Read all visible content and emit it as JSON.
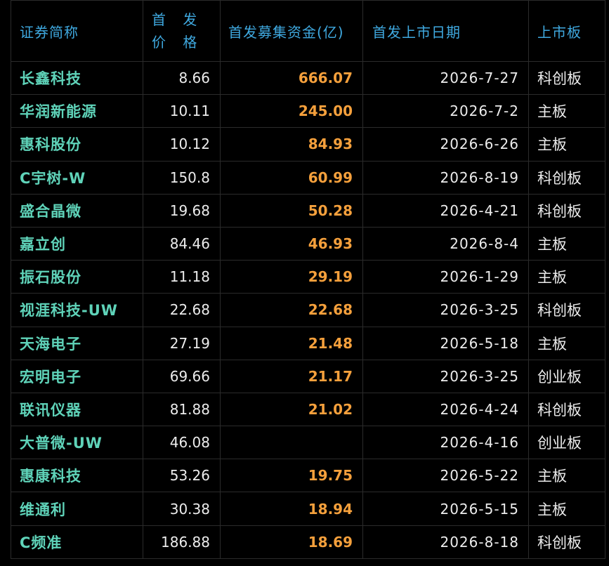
{
  "headers": {
    "name": "证券简称",
    "price": "首 发 价 格",
    "fund": "首发募集资金(亿)",
    "date": "首发上市日期",
    "board": "上市板"
  },
  "rows": [
    {
      "name": "长鑫科技",
      "price": "8.66",
      "fund": "666.07",
      "date": "2026-7-27",
      "board": "科创板"
    },
    {
      "name": "华润新能源",
      "price": "10.11",
      "fund": "245.00",
      "date": "2026-7-2",
      "board": "主板"
    },
    {
      "name": "惠科股份",
      "price": "10.12",
      "fund": "84.93",
      "date": "2026-6-26",
      "board": "主板"
    },
    {
      "name": "C宇树-W",
      "price": "150.8",
      "fund": "60.99",
      "date": "2026-8-19",
      "board": "科创板"
    },
    {
      "name": "盛合晶微",
      "price": "19.68",
      "fund": "50.28",
      "date": "2026-4-21",
      "board": "科创板"
    },
    {
      "name": "嘉立创",
      "price": "84.46",
      "fund": "46.93",
      "date": "2026-8-4",
      "board": "主板"
    },
    {
      "name": "振石股份",
      "price": "11.18",
      "fund": "29.19",
      "date": "2026-1-29",
      "board": "主板"
    },
    {
      "name": "视涯科技-UW",
      "price": "22.68",
      "fund": "22.68",
      "date": "2026-3-25",
      "board": "科创板"
    },
    {
      "name": "天海电子",
      "price": "27.19",
      "fund": "21.48",
      "date": "2026-5-18",
      "board": "主板"
    },
    {
      "name": "宏明电子",
      "price": "69.66",
      "fund": "21.17",
      "date": "2026-3-25",
      "board": "创业板"
    },
    {
      "name": "联讯仪器",
      "price": "81.88",
      "fund": "21.02",
      "date": "2026-4-24",
      "board": "科创板"
    },
    {
      "name": "大普微-UW",
      "price": "46.08",
      "fund": "",
      "date": "2026-4-16",
      "board": "创业板"
    },
    {
      "name": "惠康科技",
      "price": "53.26",
      "fund": "19.75",
      "date": "2026-5-22",
      "board": "主板"
    },
    {
      "name": "维通利",
      "price": "30.38",
      "fund": "18.94",
      "date": "2026-5-15",
      "board": "主板"
    },
    {
      "name": "C频准",
      "price": "186.88",
      "fund": "18.69",
      "date": "2026-8-18",
      "board": "科创板"
    }
  ]
}
